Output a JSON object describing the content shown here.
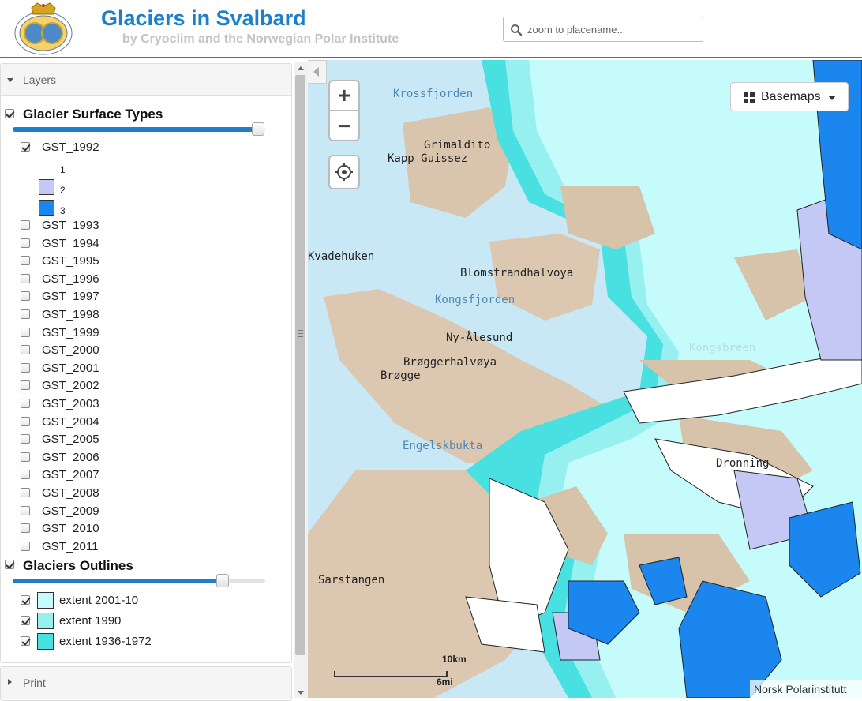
{
  "header": {
    "title": "Glaciers in Svalbard",
    "subtitle": "by Cryoclim and the Norwegian Polar Institute",
    "logo_icon": "norsk-polarinstitutt-logo",
    "search_placeholder": "zoom to placename..."
  },
  "layers_panel": {
    "heading": "Layers",
    "surface_types": {
      "label": "Glacier Surface Types",
      "checked": true,
      "opacity_percent": 100,
      "items": [
        {
          "label": "GST_1992",
          "checked": true
        },
        {
          "label": "GST_1993",
          "checked": false
        },
        {
          "label": "GST_1994",
          "checked": false
        },
        {
          "label": "GST_1995",
          "checked": false
        },
        {
          "label": "GST_1996",
          "checked": false
        },
        {
          "label": "GST_1997",
          "checked": false
        },
        {
          "label": "GST_1998",
          "checked": false
        },
        {
          "label": "GST_1999",
          "checked": false
        },
        {
          "label": "GST_2000",
          "checked": false
        },
        {
          "label": "GST_2001",
          "checked": false
        },
        {
          "label": "GST_2002",
          "checked": false
        },
        {
          "label": "GST_2003",
          "checked": false
        },
        {
          "label": "GST_2004",
          "checked": false
        },
        {
          "label": "GST_2005",
          "checked": false
        },
        {
          "label": "GST_2006",
          "checked": false
        },
        {
          "label": "GST_2007",
          "checked": false
        },
        {
          "label": "GST_2008",
          "checked": false
        },
        {
          "label": "GST_2009",
          "checked": false
        },
        {
          "label": "GST_2010",
          "checked": false
        },
        {
          "label": "GST_2011",
          "checked": false
        }
      ],
      "legend": [
        {
          "label": "1",
          "color": "#ffffff"
        },
        {
          "label": "2",
          "color": "#c3c8f4"
        },
        {
          "label": "3",
          "color": "#1a86ee"
        }
      ]
    },
    "outlines": {
      "label": "Glaciers Outlines",
      "checked": true,
      "opacity_percent": 80,
      "items": [
        {
          "label": "extent 2001-10",
          "checked": true,
          "color": "#c6fbfb"
        },
        {
          "label": "extent 1990",
          "checked": true,
          "color": "#96f0f0"
        },
        {
          "label": "extent 1936-1972",
          "checked": true,
          "color": "#48e0e0"
        }
      ]
    }
  },
  "print_panel": {
    "heading": "Print"
  },
  "map": {
    "zoom_in": "+",
    "zoom_out": "−",
    "locate_icon": "crosshair-icon",
    "basemaps_label": "Basemaps",
    "places": [
      {
        "label": "Krossfjorden",
        "kind": "sea"
      },
      {
        "label": "Grimaldito",
        "kind": "land"
      },
      {
        "label": "Kapp Guissez",
        "kind": "land"
      },
      {
        "label": "Blomstrandhalvoya",
        "kind": "land"
      },
      {
        "label": "Kvadehuken",
        "kind": "land"
      },
      {
        "label": "Kongsfjorden",
        "kind": "sea"
      },
      {
        "label": "Ny-Ålesund",
        "kind": "land"
      },
      {
        "label": "Brøggerhalvøya",
        "kind": "land"
      },
      {
        "label": "Brøgge",
        "kind": "land"
      },
      {
        "label": "Engelskbukta",
        "kind": "sea"
      },
      {
        "label": "Kongsbreen",
        "kind": "ice"
      },
      {
        "label": "Sarstangen",
        "kind": "land"
      },
      {
        "label": "Dronning",
        "kind": "land"
      }
    ],
    "scale_km": "10km",
    "scale_mi": "6mi",
    "attribution": "Norsk Polarinstitutt",
    "colors": {
      "sea": "#c9e8f6",
      "land": "#dcc8b0",
      "glacier_old": "#48e0e0",
      "glacier_mid": "#96f0f0",
      "glacier_new": "#c6fbfb"
    }
  }
}
